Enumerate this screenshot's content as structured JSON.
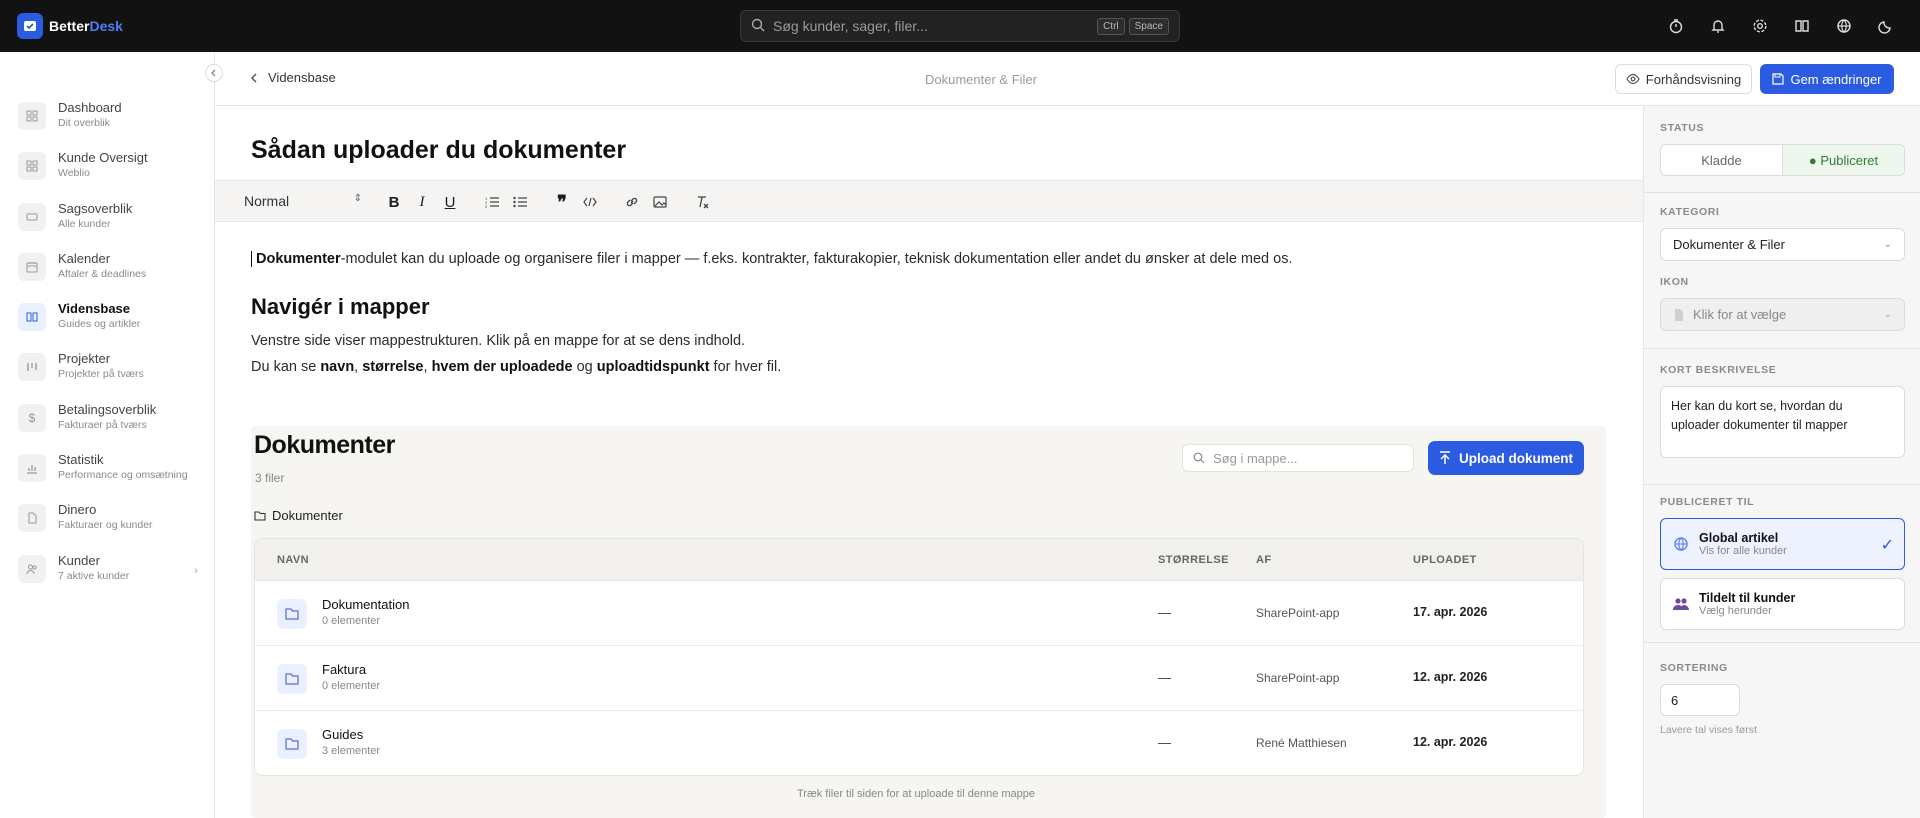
{
  "app": {
    "name_part1": "Better",
    "name_part2": "Desk"
  },
  "search": {
    "placeholder": "Søg kunder, sager, filer...",
    "kbd1": "Ctrl",
    "kbd2": "Space"
  },
  "top_icons": [
    "timer-icon",
    "bell-icon",
    "gear-icon",
    "book-icon",
    "globe-icon",
    "moon-icon"
  ],
  "sidebar": {
    "items": [
      {
        "label": "Dashboard",
        "sub": "Dit overblik",
        "icon": "grid-icon"
      },
      {
        "label": "Kunde Oversigt",
        "sub": "Weblio",
        "icon": "grid-icon"
      },
      {
        "label": "Sagsoverblik",
        "sub": "Alle kunder",
        "icon": "ticket-icon"
      },
      {
        "label": "Kalender",
        "sub": "Aftaler & deadlines",
        "icon": "calendar-icon"
      },
      {
        "label": "Vidensbase",
        "sub": "Guides og artikler",
        "icon": "book-icon"
      },
      {
        "label": "Projekter",
        "sub": "Projekter på tværs",
        "icon": "kanban-icon"
      },
      {
        "label": "Betalingsoverblik",
        "sub": "Fakturaer på tværs",
        "icon": "dollar-icon"
      },
      {
        "label": "Statistik",
        "sub": "Performance og omsætning",
        "icon": "chart-icon"
      },
      {
        "label": "Dinero",
        "sub": "Fakturaer og kunder",
        "icon": "file-icon"
      },
      {
        "label": "Kunder",
        "sub": "7 aktive kunder",
        "icon": "users-icon"
      }
    ]
  },
  "header": {
    "back_label": "Vidensbase",
    "center": "Dokumenter & Filer",
    "preview_label": "Forhåndsvisning",
    "save_label": "Gem ændringer"
  },
  "editor": {
    "title": "Sådan uploader du dokumenter",
    "format_value": "Normal",
    "p1_bold": "Dokumenter",
    "p1_rest": "-modulet kan du uploade og organisere filer i mapper — f.eks. kontrakter, fakturakopier, teknisk dokumentation eller andet du ønsker at dele med os.",
    "h2": "Navigér i mapper",
    "p2": "Venstre side viser mappestrukturen. Klik på en mappe for at se dens indhold.",
    "p3": {
      "a": "Du kan se ",
      "b1": "navn",
      "c": ", ",
      "b2": "størrelse",
      "d": ", ",
      "b3": "hvem der uploadede",
      "e": " og ",
      "b4": "uploadtidspunkt",
      "f": " for hver fil."
    }
  },
  "embed": {
    "title": "Dokumenter",
    "count": "3 filer",
    "search_placeholder": "Søg i mappe...",
    "upload_label": "Upload dokument",
    "crumb": "Dokumenter",
    "columns": {
      "name": "NAVN",
      "size": "STØRRELSE",
      "by": "AF",
      "date": "UPLOADET"
    },
    "rows": [
      {
        "name": "Dokumentation",
        "sub": "0 elementer",
        "size": "—",
        "by": "SharePoint-app",
        "date": "17. apr. 2026"
      },
      {
        "name": "Faktura",
        "sub": "0 elementer",
        "size": "—",
        "by": "SharePoint-app",
        "date": "12. apr. 2026"
      },
      {
        "name": "Guides",
        "sub": "3 elementer",
        "size": "—",
        "by": "René Matthiesen",
        "date": "12. apr. 2026"
      }
    ],
    "hint": "Træk filer til siden for at uploade til denne mappe"
  },
  "panel": {
    "status_label": "STATUS",
    "status_draft": "Kladde",
    "status_published": "● Publiceret",
    "category_label": "KATEGORI",
    "category_value": "Dokumenter & Filer",
    "icon_label": "IKON",
    "icon_value": "Klik for at vælge",
    "desc_label": "KORT BESKRIVELSE",
    "desc_value": "Her kan du kort se, hvordan du uploader dokumenter til mapper",
    "published_label": "PUBLICERET TIL",
    "global_title": "Global artikel",
    "global_sub": "Vis for alle kunder",
    "assigned_title": "Tildelt til kunder",
    "assigned_sub": "Vælg herunder",
    "sort_label": "SORTERING",
    "sort_value": "6",
    "sort_hint": "Lavere tal vises først"
  },
  "colors": {
    "accent": "#2b5be0",
    "topbar": "#121212",
    "published": "#2e7d32"
  }
}
